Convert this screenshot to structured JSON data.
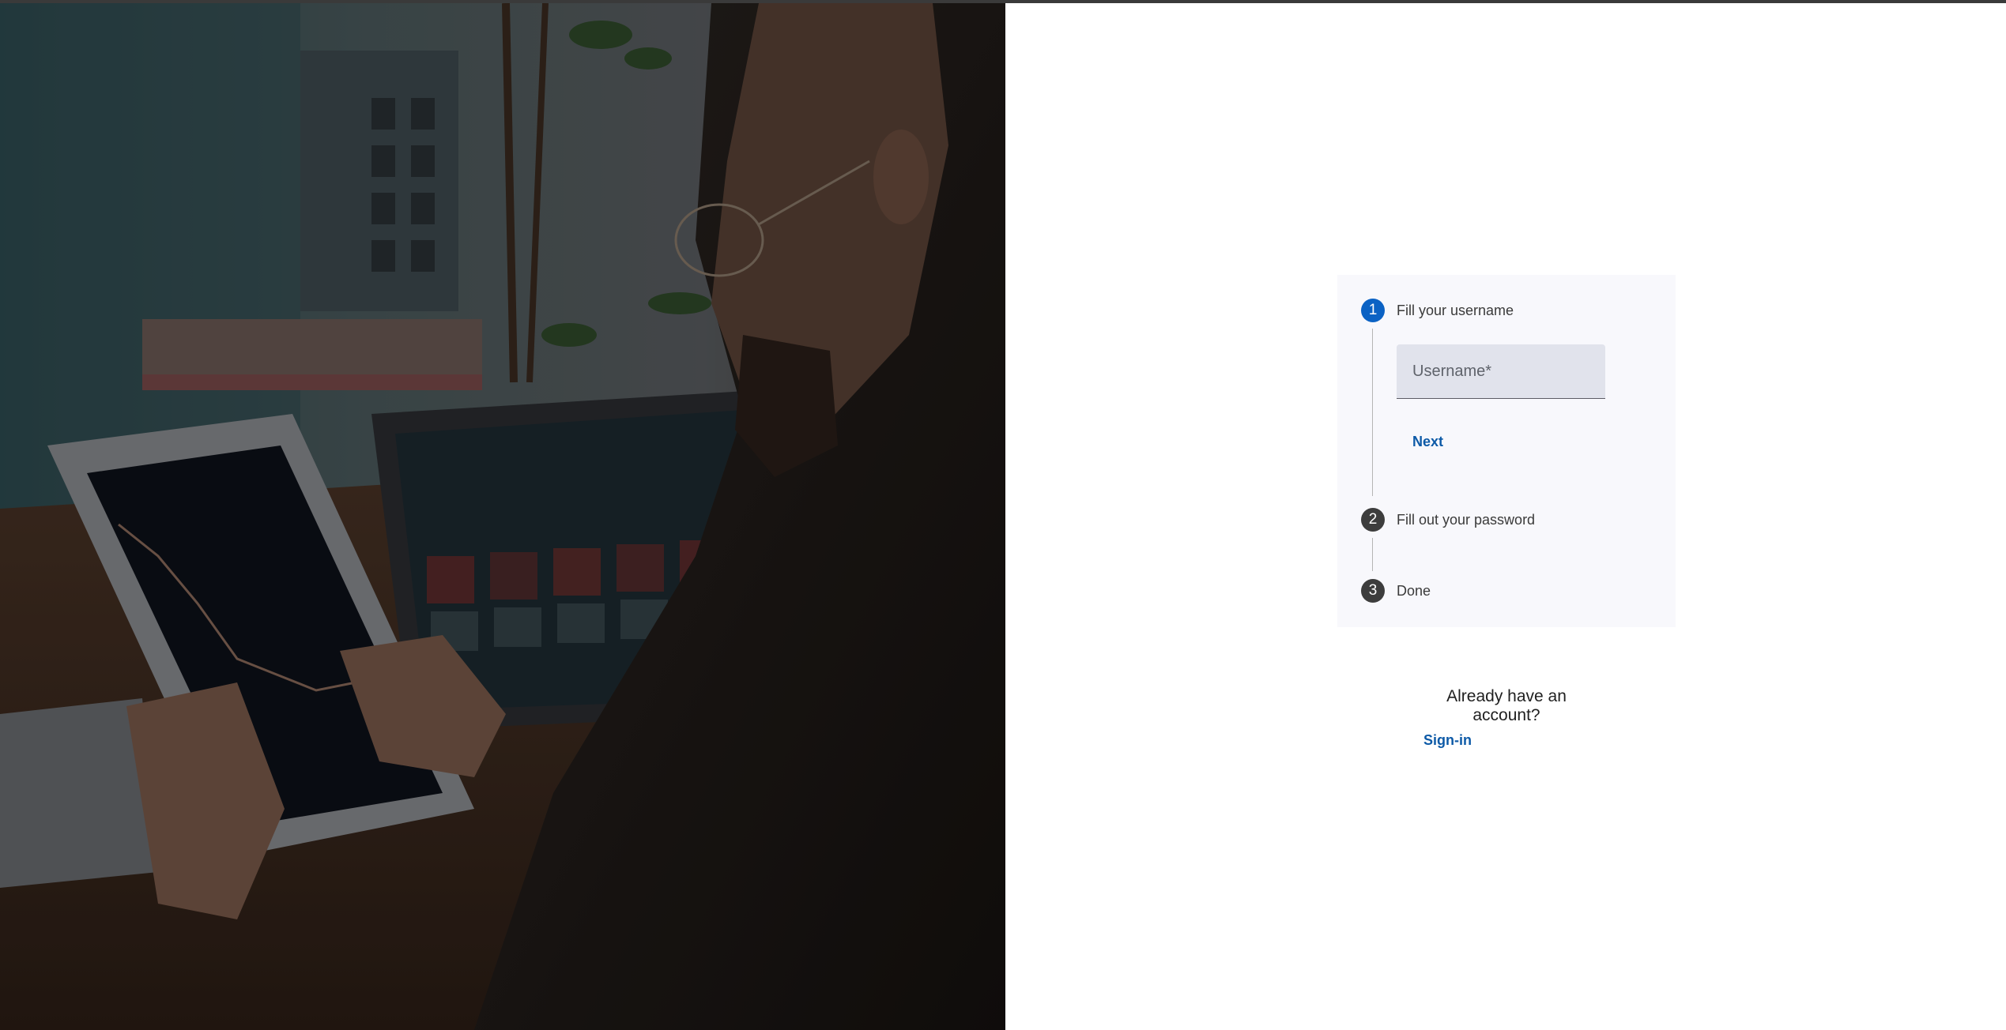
{
  "stepper": {
    "steps": [
      {
        "number": "1",
        "label": "Fill your username",
        "state": "active"
      },
      {
        "number": "2",
        "label": "Fill out your password",
        "state": "inactive"
      },
      {
        "number": "3",
        "label": "Done",
        "state": "inactive"
      }
    ],
    "username_placeholder": "Username*",
    "next_label": "Next"
  },
  "account": {
    "prompt": "Already have an account?",
    "signin_label": "Sign-in"
  },
  "colors": {
    "accent": "#0b62c4",
    "link": "#0d5aa7",
    "inactive_step": "#3d3d3d",
    "card_bg": "#f8f8fc",
    "field_bg": "#e1e3ec"
  },
  "hero_image": {
    "icon": "person-using-tablet-photo"
  }
}
